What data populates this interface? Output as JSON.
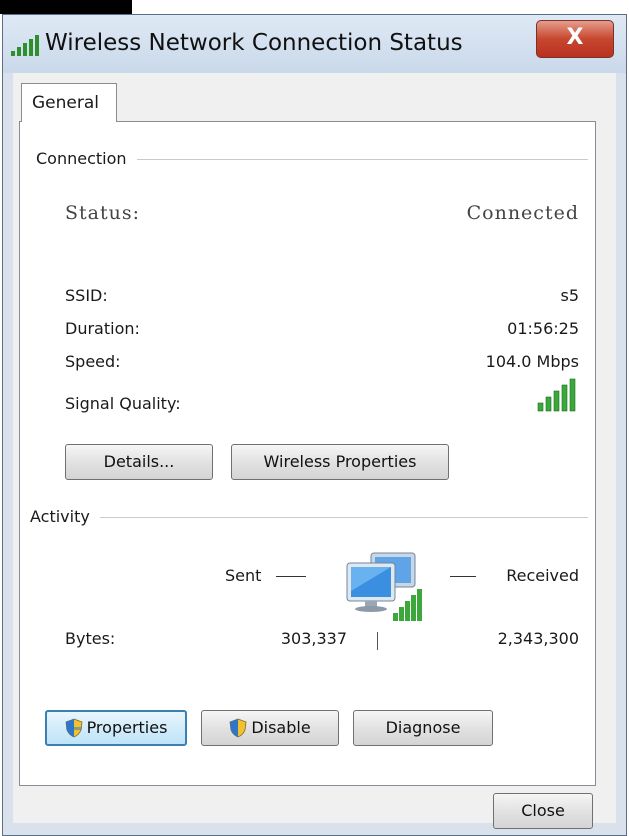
{
  "window": {
    "title": "Wireless Network Connection Status",
    "close_glyph": "X"
  },
  "tabs": [
    {
      "label": "General"
    }
  ],
  "connection": {
    "section_label": "Connection",
    "status_label": "Status:",
    "status_value": "Connected",
    "ssid_label": "SSID:",
    "ssid_value": "s5",
    "duration_label": "Duration:",
    "duration_value": "01:56:25",
    "speed_label": "Speed:",
    "speed_value": "104.0 Mbps",
    "signal_label": "Signal Quality:",
    "details_button": "Details...",
    "wireless_properties_button": "Wireless Properties"
  },
  "activity": {
    "section_label": "Activity",
    "sent_label": "Sent",
    "received_label": "Received",
    "bytes_label": "Bytes:",
    "bytes_sent": "303,337",
    "bytes_received": "2,343,300",
    "properties_button": "Properties",
    "disable_button": "Disable",
    "diagnose_button": "Diagnose"
  },
  "footer": {
    "close_button": "Close"
  },
  "icons": {
    "title": "wireless-signal-icon",
    "signal": "signal-bars-icon",
    "activity": "network-computers-icon",
    "shield": "uac-shield-icon"
  },
  "colors": {
    "signal_green": "#3aa83a",
    "focus_border": "#3c7fb1",
    "close_red": "#c7472f"
  }
}
